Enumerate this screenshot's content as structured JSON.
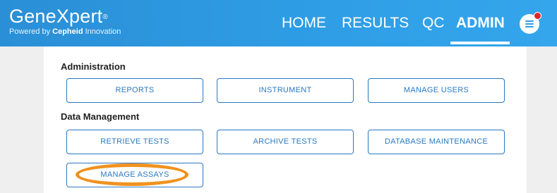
{
  "brand": {
    "name": "GeneXpert",
    "trademark": "®",
    "tagline_prefix": "Powered by",
    "tagline_brand": "Cepheid",
    "tagline_suffix": "Innovation"
  },
  "nav": {
    "items": [
      {
        "label": "HOME",
        "active": false
      },
      {
        "label": "RESULTS",
        "active": false
      },
      {
        "label": "QC",
        "active": false
      },
      {
        "label": "ADMIN",
        "active": true
      }
    ],
    "menu_icon": "hamburger-menu-icon",
    "notification_icon": "notification-dot-icon"
  },
  "sections": [
    {
      "title": "Administration",
      "buttons": [
        "REPORTS",
        "INSTRUMENT",
        "MANAGE USERS"
      ]
    },
    {
      "title": "Data Management",
      "buttons": [
        "RETRIEVE TESTS",
        "ARCHIVE TESTS",
        "DATABASE MAINTENANCE",
        "MANAGE ASSAYS"
      ]
    }
  ],
  "colors": {
    "header": "#2f9ee6",
    "button_border": "#2a79c2",
    "highlight": "#f0921e",
    "notification": "#e0252c"
  }
}
